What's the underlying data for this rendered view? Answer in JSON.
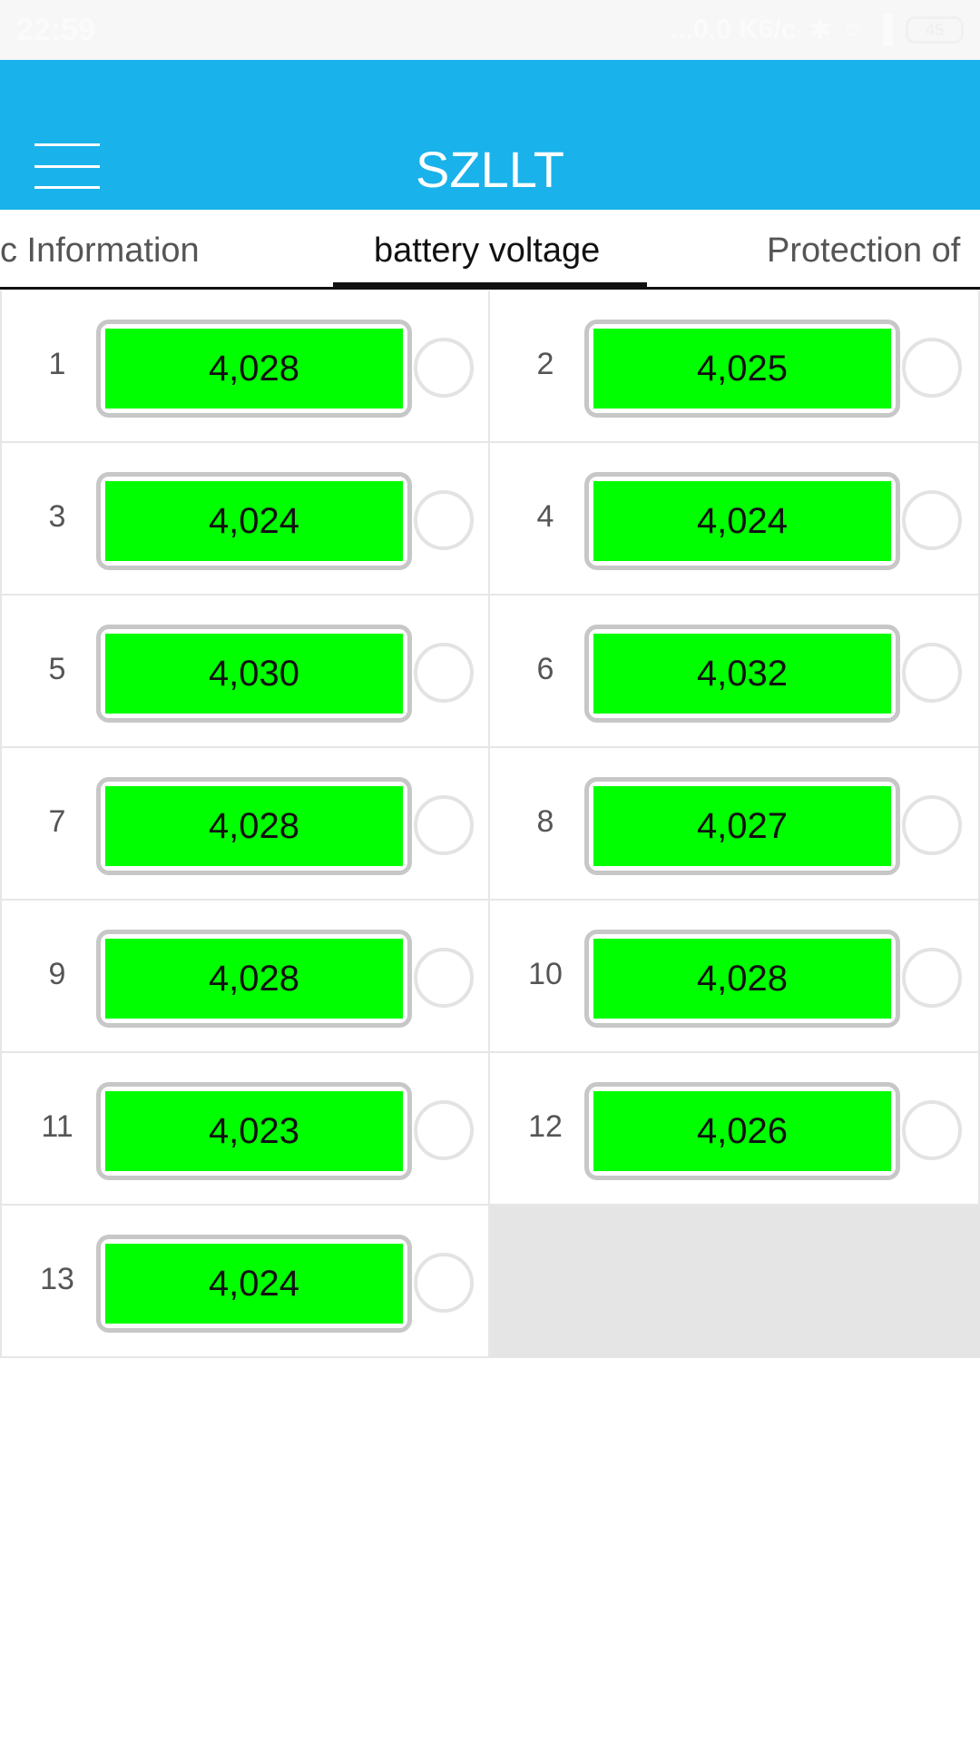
{
  "status_bar": {
    "time": "22:59",
    "network_speed": "...0,0 K6/c",
    "battery": "45"
  },
  "app_bar": {
    "title": "SZLLT"
  },
  "tabs": [
    {
      "label": "c Information"
    },
    {
      "label": "battery voltage"
    },
    {
      "label": "Protection of"
    }
  ],
  "cells": [
    {
      "index": "1",
      "voltage": "4,028"
    },
    {
      "index": "2",
      "voltage": "4,025"
    },
    {
      "index": "3",
      "voltage": "4,024"
    },
    {
      "index": "4",
      "voltage": "4,024"
    },
    {
      "index": "5",
      "voltage": "4,030"
    },
    {
      "index": "6",
      "voltage": "4,032"
    },
    {
      "index": "7",
      "voltage": "4,028"
    },
    {
      "index": "8",
      "voltage": "4,027"
    },
    {
      "index": "9",
      "voltage": "4,028"
    },
    {
      "index": "10",
      "voltage": "4,028"
    },
    {
      "index": "11",
      "voltage": "4,023"
    },
    {
      "index": "12",
      "voltage": "4,026"
    },
    {
      "index": "13",
      "voltage": "4,024"
    }
  ],
  "colors": {
    "app_bar": "#1ab2ea",
    "voltage_ok": "#00ff00"
  }
}
